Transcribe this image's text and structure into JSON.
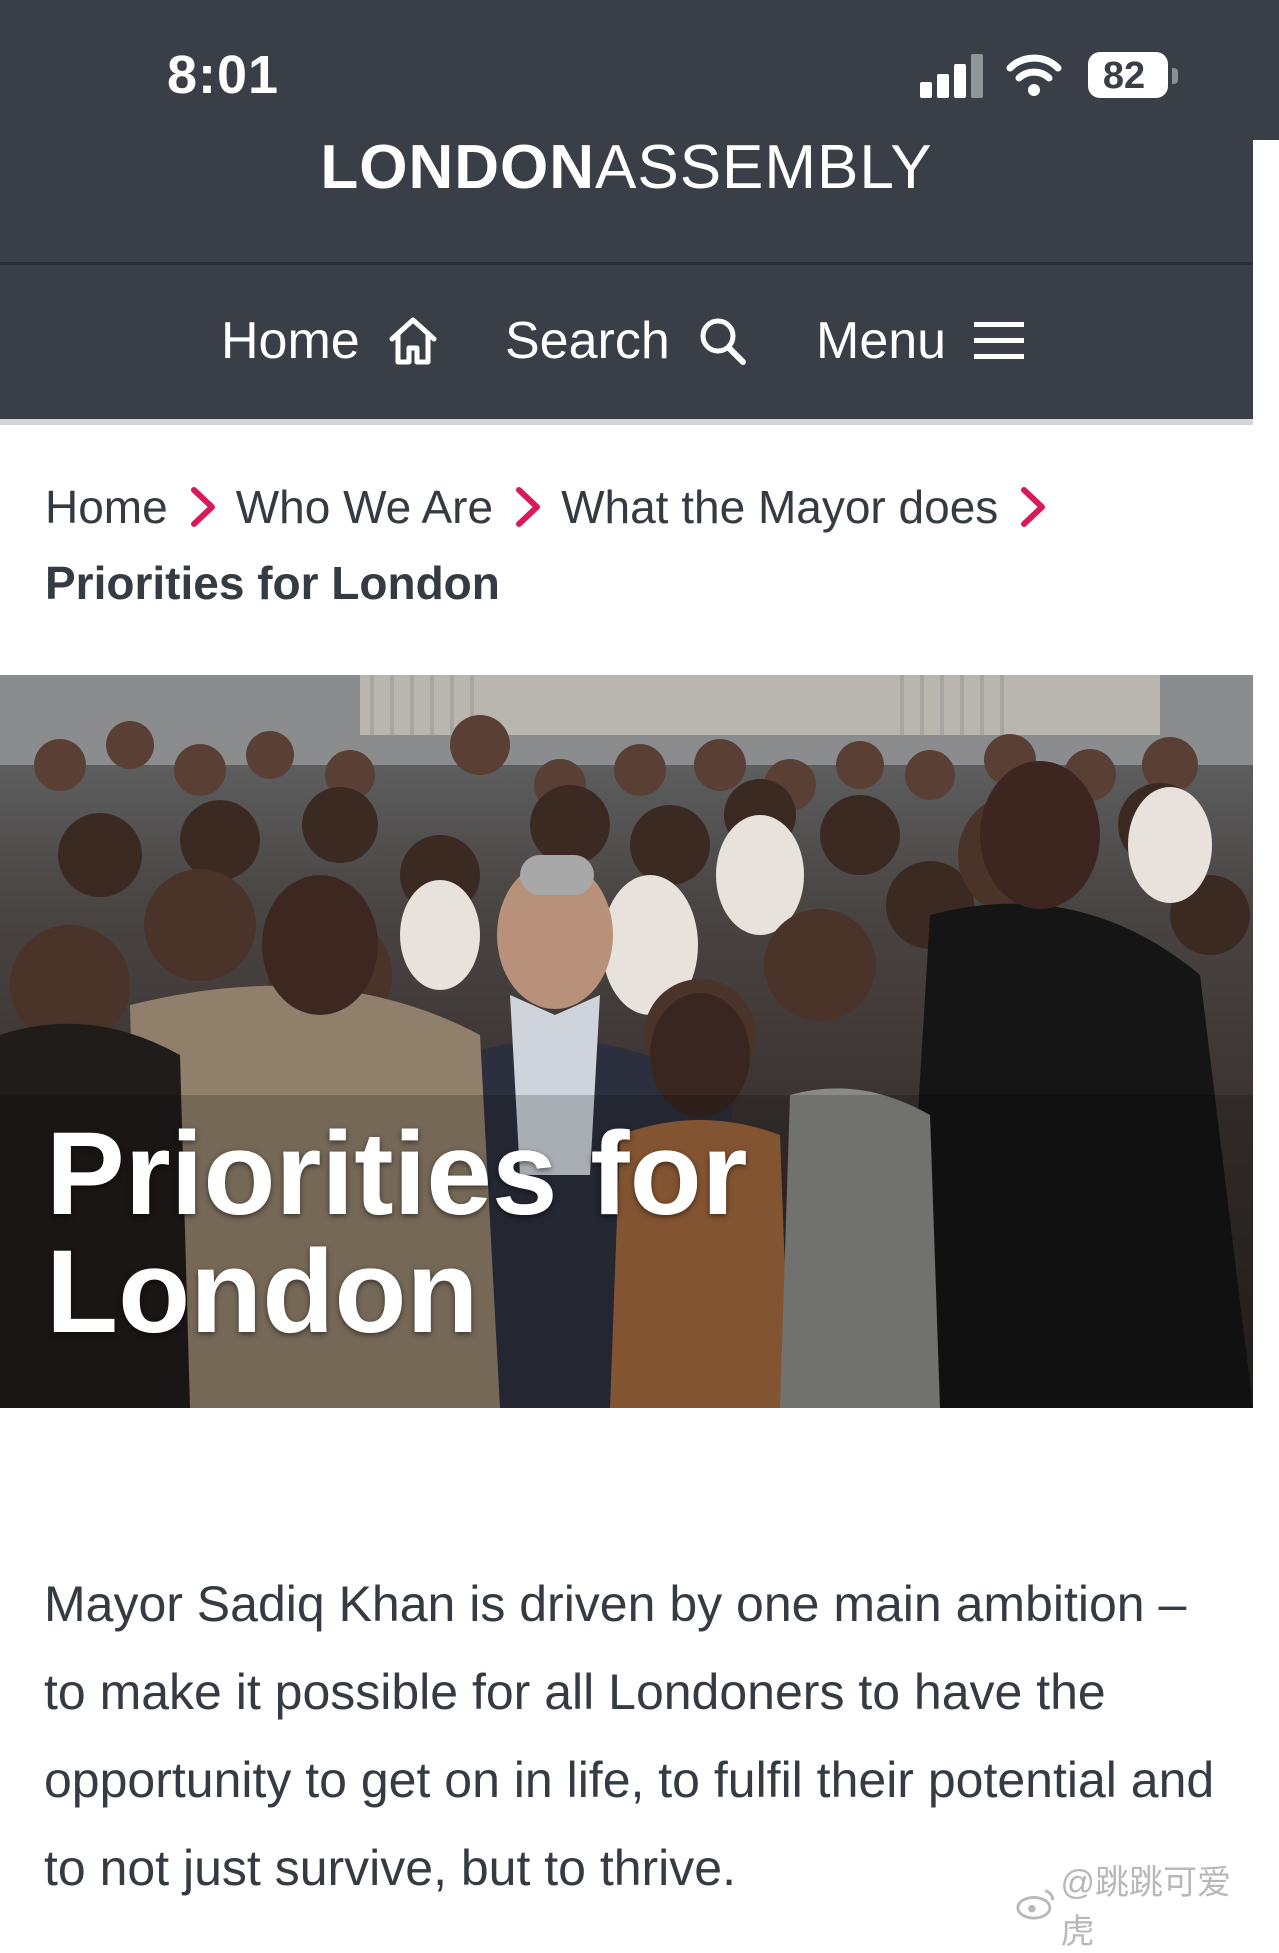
{
  "status_bar": {
    "time": "8:01",
    "battery": "82",
    "icons": [
      "signal-icon",
      "wifi-icon",
      "battery-icon"
    ]
  },
  "header": {
    "logo_bold": "LONDON",
    "logo_light": "ASSEMBLY"
  },
  "nav": {
    "home": "Home",
    "search": "Search",
    "menu": "Menu"
  },
  "breadcrumb": {
    "items": [
      "Home",
      "Who We Are",
      "What the Mayor does"
    ],
    "current": "Priorities for London"
  },
  "hero": {
    "title_line1": "Priorities for",
    "title_line2": "London",
    "image": "group-photo"
  },
  "intro": {
    "text": "Mayor Sadiq Khan is driven by one main ambition – to make it possible for all Londoners to have the opportunity to get on in life, to fulfil their potential and to not just survive, but to thrive."
  },
  "watermark": {
    "text": "@跳跳可爱虎"
  },
  "colors": {
    "header_bg": "#3a3f47",
    "chevron": "#d9195c",
    "text": "#353b43"
  }
}
